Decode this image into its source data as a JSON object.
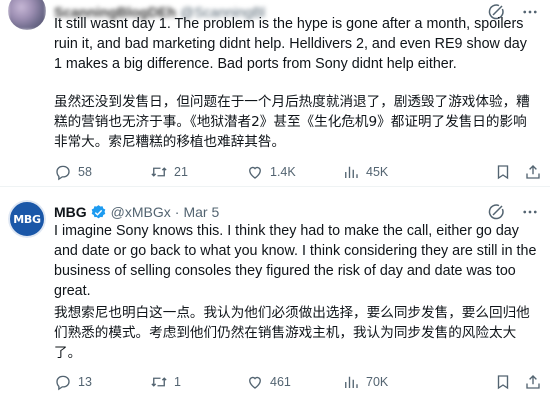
{
  "post1": {
    "author": {
      "name": "ScanningBlogDEh",
      "handle": "@ScanningBl",
      "date": "Mar 5"
    },
    "text_en": "It still wasnt day 1. The problem is the hype is gone after a month, spoilers ruin it, and bad marketing didnt help. Helldivers 2, and even RE9 show day 1 makes a big difference. Bad ports from Sony didnt help either.",
    "text_zh": "虽然还没到发售日，但问题在于一个月后热度就消退了，剧透毁了游戏体验，糟糕的营销也无济于事。《地狱潜者2》甚至《生化危机9》都证明了发售日的影响非常大。索尼糟糕的移植也难辞其咎。",
    "stats": {
      "replies": "58",
      "retweets": "21",
      "likes": "1.4K",
      "views": "45K"
    }
  },
  "post2": {
    "author": {
      "name": "MBG",
      "handle": "@xMBGx",
      "dot": "·",
      "date": "Mar 5",
      "avatar_text": "MBG"
    },
    "text_en": "I imagine Sony knows this. I think they had to make the call, either go day and date or go back to what you know. I think considering they are still in the business of selling consoles they figured the risk of day and date was too great.",
    "text_zh": "我想索尼也明白这一点。我认为他们必须做出选择，要么同步发售，要么回归他们熟悉的模式。考虑到他们仍然在销售游戏主机，我认为同步发售的风险太大了。",
    "stats": {
      "replies": "13",
      "retweets": "1",
      "likes": "461",
      "views": "70K"
    }
  },
  "colors": {
    "text": "#0f1419",
    "muted": "#536471",
    "verified": "#1d9bf0",
    "logo": "#1a57a8"
  },
  "icons": [
    "grok-icon",
    "more-icon",
    "reply-icon",
    "retweet-icon",
    "like-icon",
    "views-icon",
    "bookmark-icon",
    "share-icon",
    "verified-icon"
  ]
}
